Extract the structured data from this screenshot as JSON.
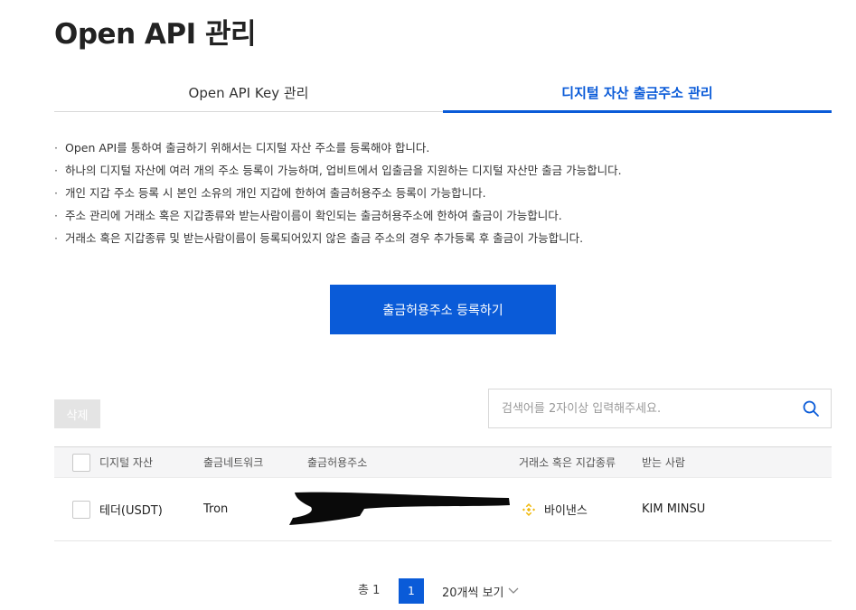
{
  "page": {
    "title": "Open API 관리"
  },
  "tabs": [
    {
      "label": "Open API Key 관리",
      "active": false
    },
    {
      "label": "디지털 자산 출금주소 관리",
      "active": true
    }
  ],
  "notices": [
    "Open API를 통하여 출금하기 위해서는 디지털 자산 주소를 등록해야 합니다.",
    "하나의 디지털 자산에 여러 개의 주소 등록이 가능하며, 업비트에서 입출금을 지원하는 디지털 자산만 출금 가능합니다.",
    "개인 지갑 주소 등록 시 본인 소유의 개인 지갑에 한하여 출금허용주소 등록이 가능합니다.",
    "주소 관리에 거래소 혹은 지갑종류와 받는사람이름이 확인되는 출금허용주소에 한하여 출금이 가능합니다.",
    "거래소 혹은 지갑종류 및 받는사람이름이 등록되어있지 않은 출금 주소의 경우 추가등록 후 출금이 가능합니다."
  ],
  "register_button": "출금허용주소 등록하기",
  "delete_button": "삭제",
  "search": {
    "placeholder": "검색어를 2자이상 입력해주세요.",
    "value": "",
    "icon": "search-icon"
  },
  "table": {
    "headers": {
      "asset": "디지털 자산",
      "network": "출금네트워크",
      "address": "출금허용주소",
      "exchange": "거래소 혹은 지갑종류",
      "recipient": "받는 사람"
    },
    "rows": [
      {
        "asset": "테더(USDT)",
        "network": "Tron",
        "address": "",
        "exchange": "바이낸스",
        "exchange_icon": "binance-icon",
        "recipient": "KIM MINSU"
      }
    ]
  },
  "pagination": {
    "total": "총 1",
    "current_page": "1",
    "per_page": "20개씩 보기"
  },
  "colors": {
    "accent": "#0a5bd8",
    "binance": "#f0b90b",
    "header_bg": "#f5f5f6"
  }
}
